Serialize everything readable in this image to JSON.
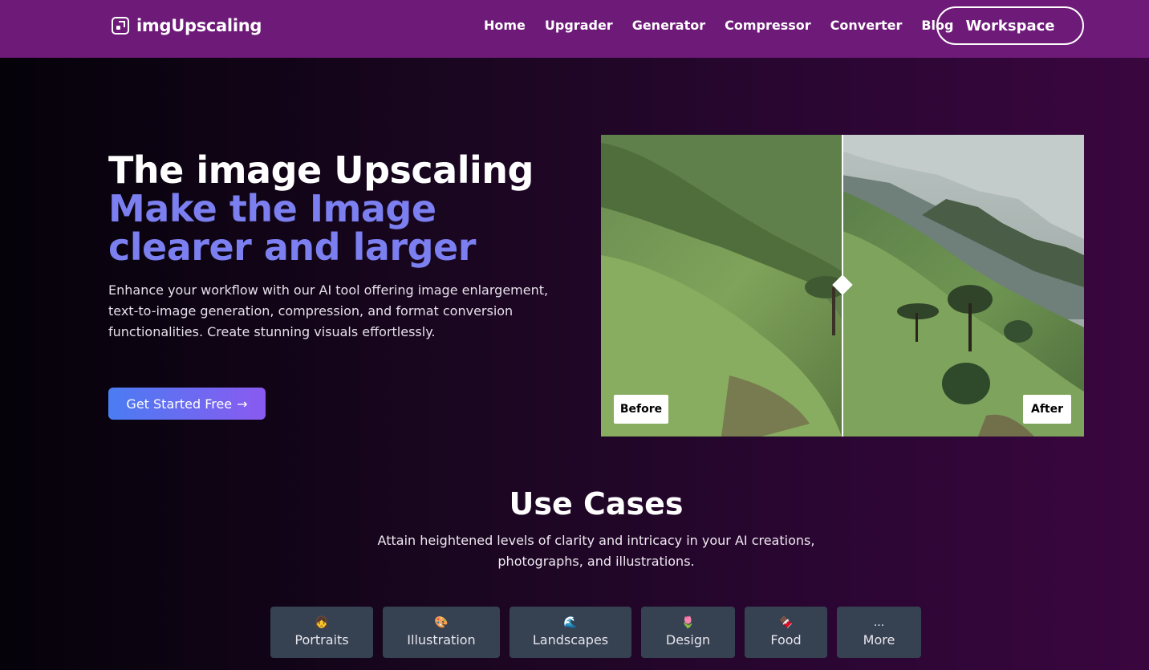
{
  "brand": {
    "name": "imgUpscaling"
  },
  "nav": {
    "links": [
      "Home",
      "Upgrader",
      "Generator",
      "Compressor",
      "Converter",
      "Blog"
    ],
    "workspace": "Workspace"
  },
  "hero": {
    "title_line1": "The image Upscaling",
    "title_line2": "Make the Image clearer and larger",
    "description": "Enhance your workflow with our AI tool offering image enlargement, text-to-image generation, compression, and format conversion functionalities. Create stunning visuals effortlessly.",
    "cta": "Get Started Free",
    "cta_arrow": "→"
  },
  "compare": {
    "before": "Before",
    "after": "After"
  },
  "use_cases": {
    "title": "Use Cases",
    "desc_line1": "Attain heightened levels of clarity and intricacy in your AI creations,",
    "desc_line2": "photographs, and illustrations.",
    "categories": [
      {
        "icon": "👧",
        "label": "Portraits"
      },
      {
        "icon": "🎨",
        "label": "Illustration"
      },
      {
        "icon": "🌊",
        "label": "Landscapes"
      },
      {
        "icon": "🌷",
        "label": "Design"
      },
      {
        "icon": "🍫",
        "label": "Food"
      },
      {
        "icon": "...",
        "label": "More"
      }
    ]
  },
  "colors": {
    "nav_bg": "#6e1a78",
    "accent": "#7b7ff0",
    "card_bg": "#364252"
  }
}
